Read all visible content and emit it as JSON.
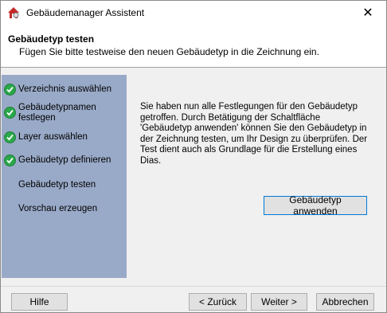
{
  "window": {
    "title": "Gebäudemanager Assistent",
    "app_icon": "app-icon",
    "close_glyph": "✕"
  },
  "header": {
    "title": "Gebäudetyp testen",
    "subtitle": "Fügen Sie bitte testweise den neuen Gebäudetyp in die Zeichnung ein."
  },
  "steps": [
    {
      "label": "Verzeichnis auswählen",
      "done": true
    },
    {
      "label": "Gebäudetypnamen festlegen",
      "done": true
    },
    {
      "label": "Layer auswählen",
      "done": true
    },
    {
      "label": "Gebäudetyp definieren",
      "done": true
    },
    {
      "label": "Gebäudetyp testen",
      "done": false
    },
    {
      "label": "Vorschau erzeugen",
      "done": false
    }
  ],
  "content": {
    "description": "Sie haben nun alle Festlegungen für den Gebäudetyp getroffen. Durch Betätigung der Schaltfläche 'Gebäudetyp anwenden' können Sie den Gebäudetyp in der Zeichnung testen, um Ihr Design zu überprüfen. Der Test dient auch als Grundlage für die Erstellung eines Dias.",
    "apply_button": "Gebäudetyp anwenden"
  },
  "footer": {
    "help": "Hilfe",
    "back": "< Zurück",
    "next": "Weiter >",
    "cancel": "Abbrechen"
  },
  "colors": {
    "sidebar": "#99aac8",
    "check": "#2aa84a",
    "focus_border": "#0078d7"
  }
}
